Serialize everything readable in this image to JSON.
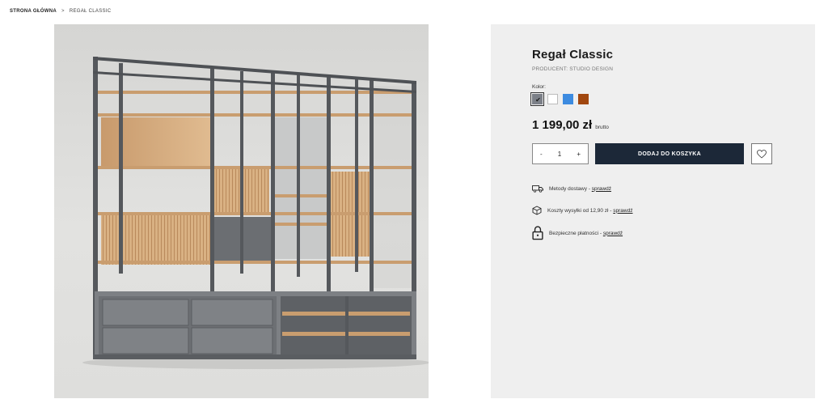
{
  "breadcrumb": {
    "home": "STRONA GŁÓWNA",
    "separator": ">",
    "current": "REGAŁ CLASSIC"
  },
  "product": {
    "title": "Regał Classic",
    "producer": "PRODUCENT: STUDIO DESIGN",
    "color_label": "Kolor:",
    "colors": [
      {
        "name": "grey",
        "hex": "#7c8088",
        "selected": true
      },
      {
        "name": "white",
        "hex": "#ffffff",
        "selected": false
      },
      {
        "name": "blue",
        "hex": "#3d8be0",
        "selected": false
      },
      {
        "name": "brown",
        "hex": "#a1470f",
        "selected": false
      }
    ],
    "price": "1 199,00 zł",
    "price_suffix": "brutto",
    "quantity": {
      "minus": "-",
      "value": "1",
      "plus": "+"
    },
    "add_to_cart": "DODAJ DO KOSZYKA",
    "wishlist_icon": "heart-icon"
  },
  "info": [
    {
      "icon": "truck-icon",
      "text": "Metody dostawy - ",
      "link": "sprawdź"
    },
    {
      "icon": "box-icon",
      "text": "Koszty wysyłki od 12,90 zł - ",
      "link": "sprawdź"
    },
    {
      "icon": "lock-icon",
      "text": "Bezpieczne płatności - ",
      "link": "sprawdź"
    }
  ],
  "colors": {
    "button_dark": "#1c2838",
    "panel_bg": "#efefef"
  }
}
